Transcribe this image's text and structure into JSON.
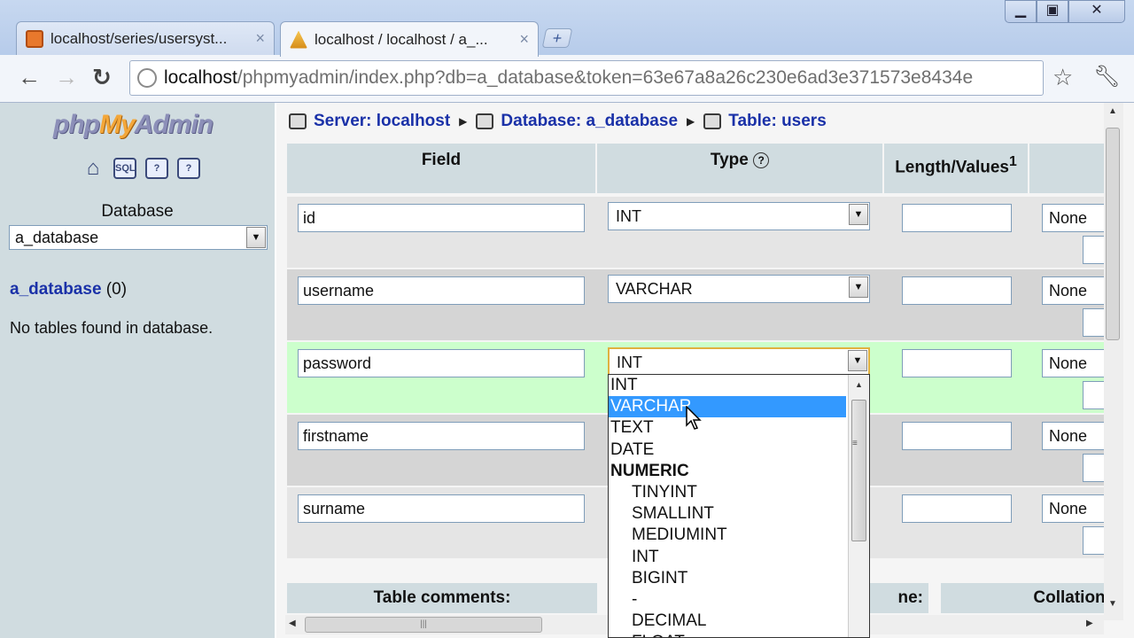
{
  "browser": {
    "tabs": [
      {
        "label": "localhost/series/usersyst...",
        "close": "×"
      },
      {
        "label": "localhost / localhost / a_...",
        "close": "×"
      }
    ],
    "new_tab": "+",
    "url_host": "localhost",
    "url_path": "/phpmyadmin/index.php?db=a_database&token=63e67a8a26c230e6ad3e371573e8434e",
    "window_buttons": {
      "minimize": "▁",
      "maximize": "▣",
      "close": "✕"
    }
  },
  "sidebar": {
    "logo": {
      "php": "php",
      "my": "My",
      "admin": "Admin"
    },
    "icons": [
      "home-icon",
      "sql-icon",
      "query-icon",
      "docs-icon"
    ],
    "icon_labels": {
      "sql": "SQL",
      "query": "?",
      "docs": "?"
    },
    "database_label": "Database",
    "database_selected": "a_database",
    "db_link": "a_database",
    "db_count": "(0)",
    "no_tables": "No tables found in database."
  },
  "breadcrumb": {
    "server": "Server: localhost",
    "database": "Database: a_database",
    "table": "Table: users"
  },
  "columns": {
    "field": "Field",
    "type": "Type",
    "help": "?",
    "length": "Length/Values",
    "length_sup": "1"
  },
  "rows": [
    {
      "field": "id",
      "type": "INT",
      "default": "None"
    },
    {
      "field": "username",
      "type": "VARCHAR",
      "default": "None"
    },
    {
      "field": "password",
      "type": "INT",
      "default": "None"
    },
    {
      "field": "firstname",
      "type": "",
      "default": "None"
    },
    {
      "field": "surname",
      "type": "",
      "default": "None"
    }
  ],
  "footer": {
    "table_comments": "Table comments:",
    "engine": "ne:",
    "collation": "Collation:"
  },
  "type_dropdown": {
    "items": [
      {
        "label": "INT",
        "kind": "item"
      },
      {
        "label": "VARCHAR",
        "kind": "selected"
      },
      {
        "label": "TEXT",
        "kind": "item"
      },
      {
        "label": "DATE",
        "kind": "item"
      },
      {
        "label": "NUMERIC",
        "kind": "group"
      },
      {
        "label": "TINYINT",
        "kind": "indent"
      },
      {
        "label": "SMALLINT",
        "kind": "indent"
      },
      {
        "label": "MEDIUMINT",
        "kind": "indent"
      },
      {
        "label": "INT",
        "kind": "indent"
      },
      {
        "label": "BIGINT",
        "kind": "indent"
      },
      {
        "label": "-",
        "kind": "indent"
      },
      {
        "label": "DECIMAL",
        "kind": "indent"
      },
      {
        "label": "FLOAT",
        "kind": "indent"
      }
    ]
  },
  "colors": {
    "nav_bg": "#d0dce0",
    "link": "#1a31a8",
    "hover_row": "#ccffcc",
    "selection": "#3399ff"
  }
}
